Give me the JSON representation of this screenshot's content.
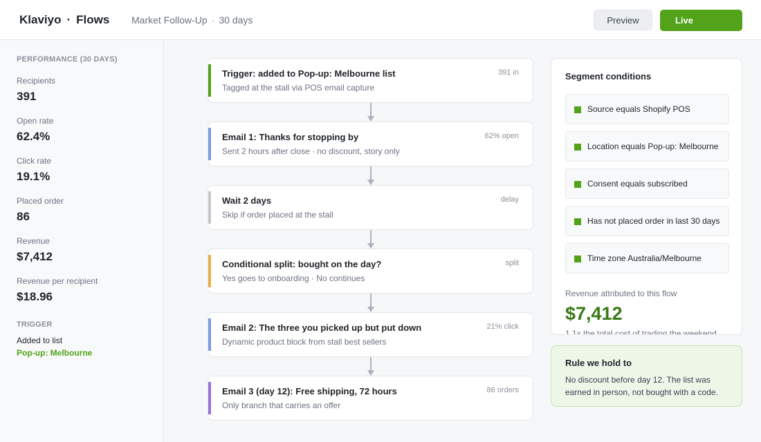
{
  "header": {
    "brand": "Klaviyo",
    "brand_sep": "·",
    "section": "Flows",
    "flow_name": "Market Follow-Up",
    "crumb_sep": "·",
    "period": "30 days",
    "preview_label": "Preview",
    "live_label": "Live"
  },
  "sidebar": {
    "performance_title": "PERFORMANCE (30 DAYS)",
    "metrics": [
      {
        "label": "Recipients",
        "value": "391"
      },
      {
        "label": "Open rate",
        "value": "62.4%"
      },
      {
        "label": "Click rate",
        "value": "19.1%"
      },
      {
        "label": "Placed order",
        "value": "86"
      },
      {
        "label": "Revenue",
        "value": "$7,412"
      },
      {
        "label": "Revenue per recipient",
        "value": "$18.96"
      }
    ],
    "trigger_title": "TRIGGER",
    "trigger_text": "Added to list",
    "trigger_list": "Pop-up: Melbourne"
  },
  "flow": {
    "steps": [
      {
        "title": "Trigger: added to Pop-up: Melbourne list",
        "sub": "Tagged at the stall via POS email capture",
        "meta": "391 in",
        "accent": "#52a31a"
      },
      {
        "title": "Email 1: Thanks for stopping by",
        "sub": "Sent 2 hours after close · no discount, story only",
        "meta": "62% open",
        "accent": "#7b9be0"
      },
      {
        "title": "Wait 2 days",
        "sub": "Skip if order placed at the stall",
        "meta": "delay",
        "accent": "#c5c9cf"
      },
      {
        "title": "Conditional split: bought on the day?",
        "sub": "Yes goes to onboarding · No continues",
        "meta": "split",
        "accent": "#e8b04a"
      },
      {
        "title": "Email 2: The three you picked up but put down",
        "sub": "Dynamic product block from stall best sellers",
        "meta": "21% click",
        "accent": "#7b9be0"
      },
      {
        "title": "Email 3 (day 12): Free shipping, 72 hours",
        "sub": "Only branch that carries an offer",
        "meta": "86 orders",
        "accent": "#9b72d6"
      }
    ]
  },
  "segment": {
    "title": "Segment conditions",
    "conditions": [
      "Source equals Shopify POS",
      "Location equals Pop-up: Melbourne",
      "Consent equals subscribed",
      "Has not placed order in last 30 days",
      "Time zone Australia/Melbourne"
    ],
    "revenue_label": "Revenue attributed to this flow",
    "revenue_value": "$7,412",
    "revenue_note": "1.1x the total cost of trading the weekend"
  },
  "rule": {
    "title": "Rule we hold to",
    "text": "No discount before day 12. The list was earned in person, not bought with a code."
  },
  "colors": {
    "brand_green": "#52a31a",
    "revenue_green": "#3a7a16",
    "rule_bg": "#eef6e8"
  }
}
